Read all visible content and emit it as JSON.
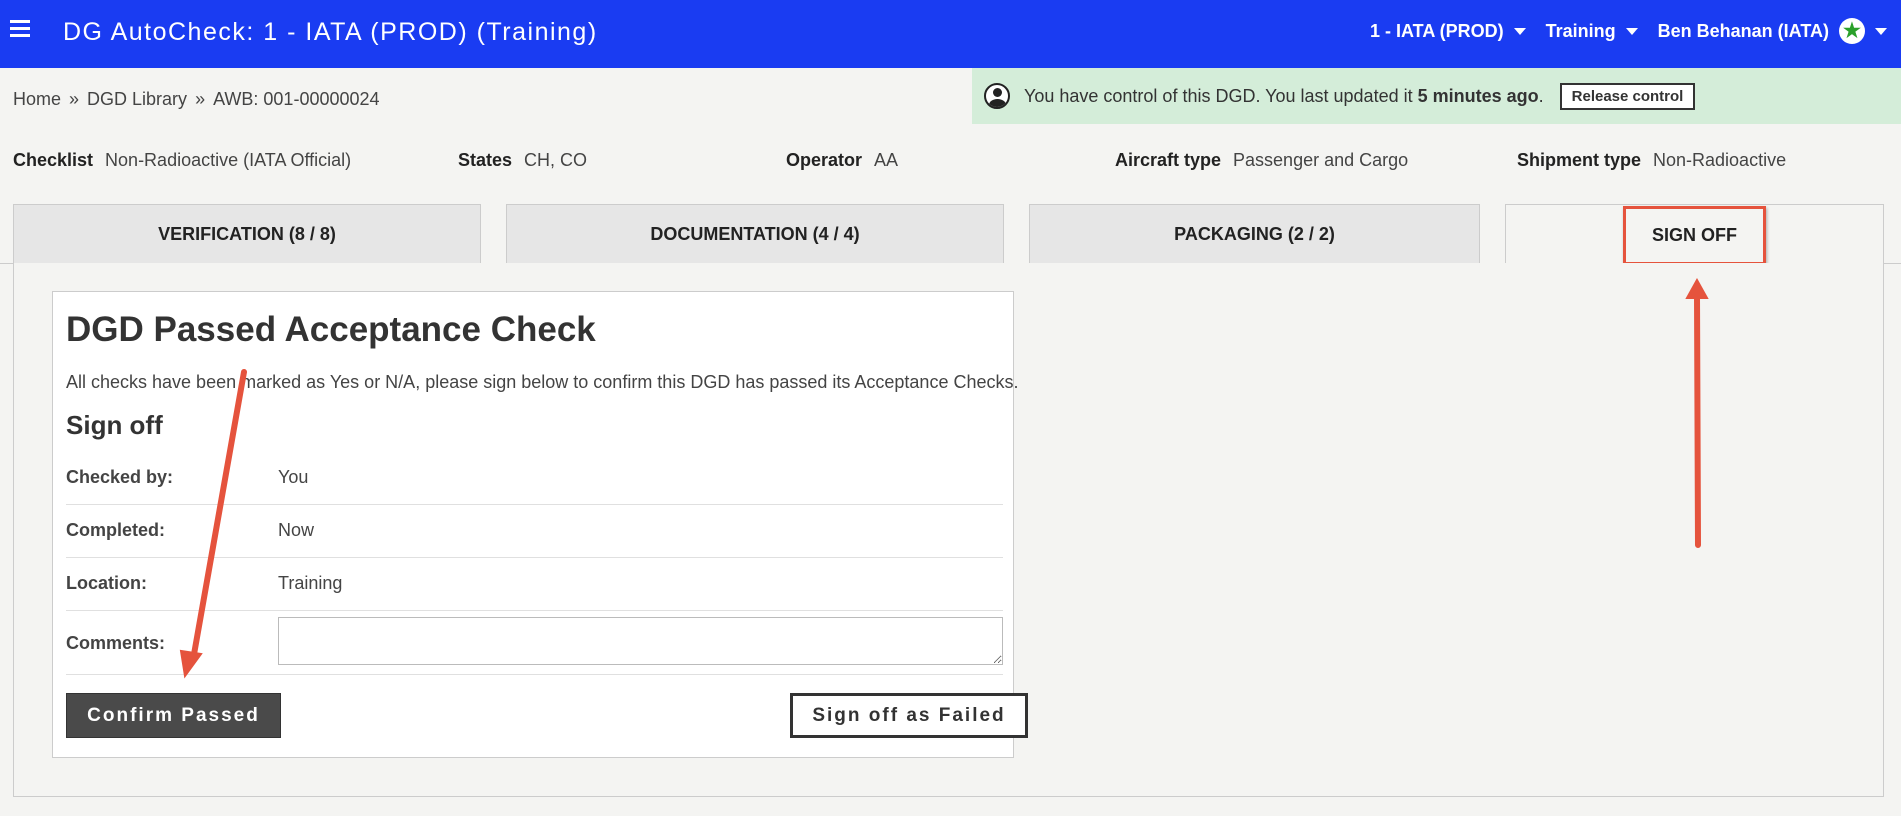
{
  "header": {
    "title": "DG AutoCheck: 1 - IATA (PROD) (Training)",
    "menus": [
      {
        "label": "1 - IATA (PROD)"
      },
      {
        "label": "Training"
      },
      {
        "label": "Ben Behanan (IATA)"
      }
    ]
  },
  "breadcrumb": {
    "items": [
      "Home",
      "DGD Library",
      "AWB: 001-00000024"
    ],
    "separator": "»"
  },
  "control_banner": {
    "text_before": "You have control of this DGD. You last updated it ",
    "time_ago": "5 minutes ago",
    "text_after": ".",
    "release_label": "Release control",
    "bg_color": "#d4edd9"
  },
  "info": {
    "checklist": {
      "label": "Checklist",
      "value": "Non-Radioactive (IATA Official)"
    },
    "states": {
      "label": "States",
      "value": "CH, CO"
    },
    "operator": {
      "label": "Operator",
      "value": "AA"
    },
    "aircraft_type": {
      "label": "Aircraft type",
      "value": "Passenger and Cargo"
    },
    "shipment_type": {
      "label": "Shipment type",
      "value": "Non-Radioactive"
    }
  },
  "tabs": [
    {
      "label": "VERIFICATION (8 / 8)"
    },
    {
      "label": "DOCUMENTATION (4 / 4)"
    },
    {
      "label": "PACKAGING (2 / 2)"
    },
    {
      "label": "SIGN OFF"
    }
  ],
  "signoff": {
    "heading": "DGD Passed Acceptance Check",
    "description": "All checks have been marked as Yes or N/A, please sign below to confirm this DGD has passed its Acceptance Checks.",
    "subheading": "Sign off",
    "rows": [
      {
        "label": "Checked by:",
        "value": "You"
      },
      {
        "label": "Completed:",
        "value": "Now"
      },
      {
        "label": "Location:",
        "value": "Training"
      }
    ],
    "comments_label": "Comments:",
    "comments_value": "",
    "confirm_label": "Confirm Passed",
    "failed_label": "Sign off as Failed"
  },
  "colors": {
    "topbar": "#1a3cf2",
    "annotation": "#e5533d",
    "star": "#2aa02a"
  },
  "icons": {
    "menu": "hamburger-icon",
    "user_status": "star-icon",
    "banner_user": "user-circle-icon"
  }
}
